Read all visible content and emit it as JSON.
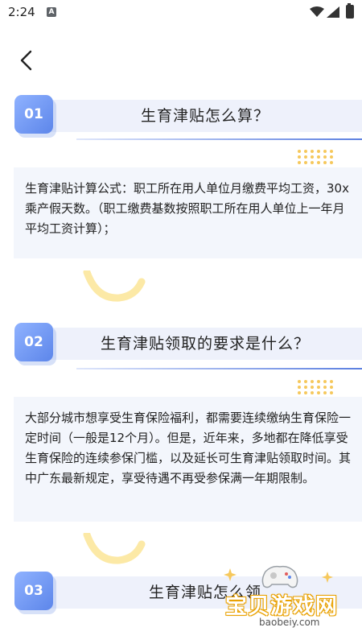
{
  "status_bar": {
    "time": "2:24",
    "notification_icon": "A"
  },
  "nav": {
    "back_icon": "chevron-left"
  },
  "sections": [
    {
      "number": "01",
      "title": "生育津贴怎么算？",
      "content": "生育津贴计算公式：职工所在用人单位月缴费平均工资，30x乘产假天数。（职工缴费基数按照职工所在用人单位上一年月平均工资计算）；"
    },
    {
      "number": "02",
      "title": "生育津贴领取的要求是什么？",
      "content": "大部分城市想享受生育保险福利，都需要连续缴纳生育保险一定时间（一般是12个月）。但是，近年来，多地都在降低享受生育保险的连续参保门槛，以及延长可生育津贴领取时间。其中广东最新规定，享受待遇不再受参保满一年期限制。"
    },
    {
      "number": "03",
      "title": "生育津贴怎么领"
    }
  ],
  "watermark": {
    "brand": "宝贝游戏网",
    "url": "baobeiy.com"
  },
  "colors": {
    "accent": "#5d86ea",
    "band": "#eef1fb",
    "card": "#f3f6fc",
    "dots": "#f6c85c",
    "swirl": "#fce9a6"
  }
}
